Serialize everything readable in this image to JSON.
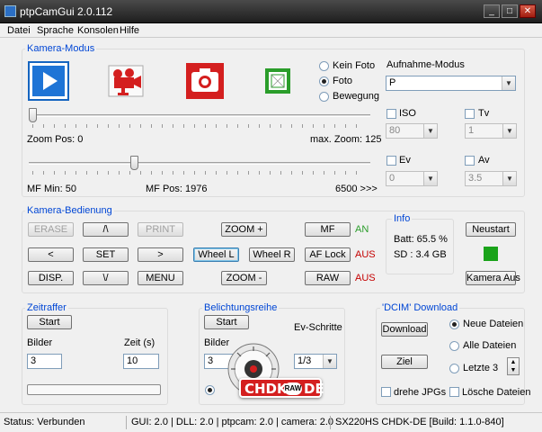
{
  "window": {
    "title": "ptpCamGui 2.0.112",
    "minimize": "_",
    "maximize": "□",
    "close": "✕"
  },
  "menu": [
    "Datei",
    "Sprache",
    "Konsolen",
    "Hilfe"
  ],
  "kamera_modus": {
    "title": "Kamera-Modus",
    "radios": [
      "Kein Foto",
      "Foto",
      "Bewegung"
    ],
    "radio_selected": "Foto",
    "aufnahme_label": "Aufnahme-Modus",
    "aufnahme_value": "P",
    "iso_label": "ISO",
    "iso_value": "80",
    "tv_label": "Tv",
    "tv_value": "1",
    "ev_label": "Ev",
    "ev_value": "0",
    "av_label": "Av",
    "av_value": "3.5",
    "zoom_pos": "Zoom Pos: 0",
    "max_zoom": "max. Zoom: 125",
    "mf_min": "MF Min: 50",
    "mf_pos": "MF Pos: 1976",
    "mf_max": "6500 >>>",
    "zoom_fraction": 0,
    "mf_fraction": 0.297
  },
  "bedienung": {
    "title": "Kamera-Bedienung",
    "buttons": {
      "erase": "ERASE",
      "up": "/\\",
      "print": "PRINT",
      "zoom_plus": "ZOOM +",
      "mf": "MF",
      "left": "<",
      "set": "SET",
      "right": ">",
      "wheel_l": "Wheel L",
      "wheel_r": "Wheel R",
      "af_lock": "AF Lock",
      "disp": "DISP.",
      "down": "\\/",
      "menu": "MENU",
      "zoom_minus": "ZOOM -",
      "raw": "RAW"
    },
    "status_mf": "AN",
    "status_af": "AUS",
    "status_raw": "AUS"
  },
  "info": {
    "title": "Info",
    "batt": "Batt: 65.5 %",
    "sd": "SD   : 3.4 GB",
    "neustart": "Neustart",
    "kamera_aus": "Kamera Aus",
    "led_color": "#1aa31a"
  },
  "zeitraffer": {
    "title": "Zeitraffer",
    "start": "Start",
    "bilder_label": "Bilder",
    "bilder_value": "3",
    "zeit_label": "Zeit (s)",
    "zeit_value": "10"
  },
  "belichtungsreihe": {
    "title": "Belichtungsreihe",
    "start": "Start",
    "ev_label": "Ev-Schritte",
    "bilder_label": "Bilder",
    "bilder_value": "3",
    "ev_value": "1/3"
  },
  "dcim": {
    "title": "'DCIM' Download",
    "download": "Download",
    "ziel": "Ziel",
    "neue": "Neue Dateien",
    "alle": "Alle Dateien",
    "letzte": "Letzte 3",
    "selected": "Neue Dateien",
    "drehe": "drehe JPGs",
    "loesche": "Lösche Dateien"
  },
  "status": {
    "connected": "Status: Verbunden",
    "versions": "GUI: 2.0 | DLL: 2.0 | ptpcam: 2.0 | camera: 2.0",
    "build": "SX220HS CHDK-DE [Build: 1.1.0-840]"
  },
  "watermark": {
    "text": "CHDK",
    "raw": "RAW",
    "de": "DE"
  },
  "colors": {
    "group_title": "#0046d5",
    "status_red": "#c40000",
    "status_green": "#2a9d2a",
    "brand_red": "#d41f1f"
  }
}
